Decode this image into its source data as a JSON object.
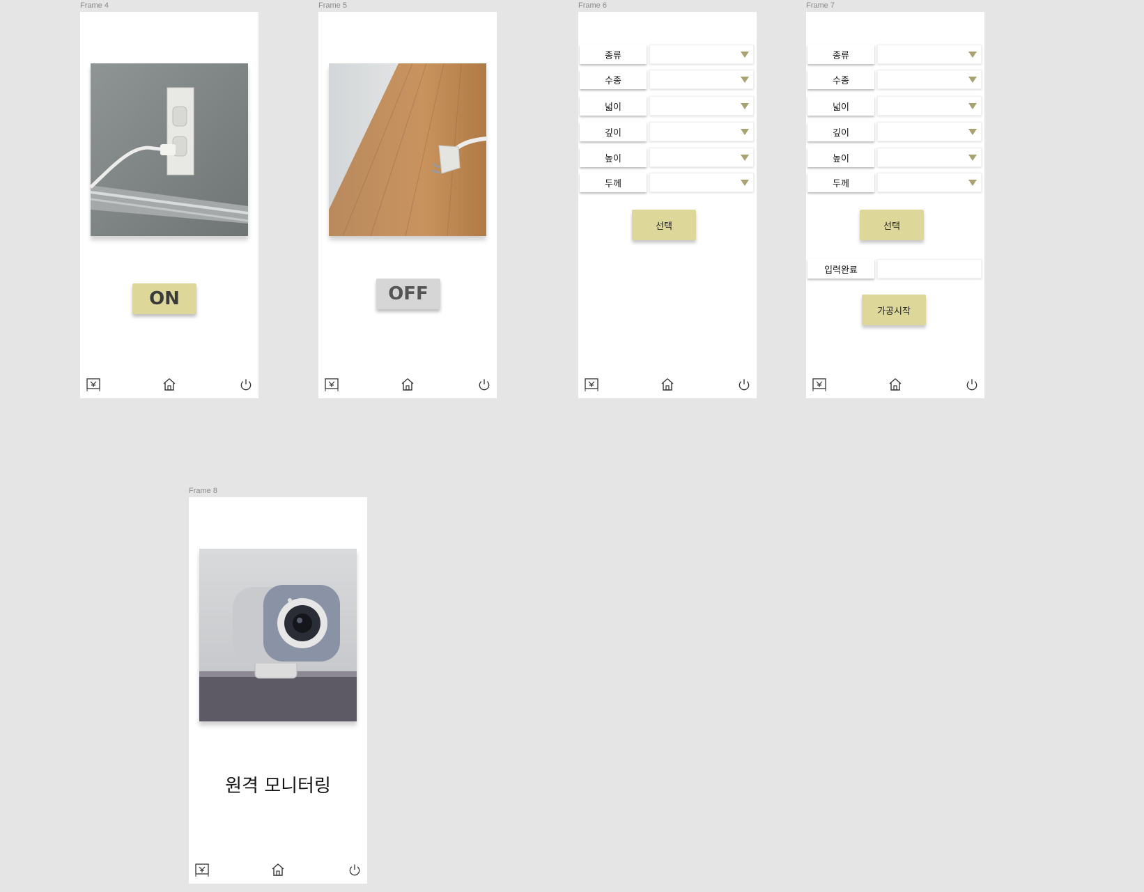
{
  "frames": {
    "f4": {
      "label": "Frame 4",
      "button": "ON"
    },
    "f5": {
      "label": "Frame 5",
      "button": "OFF"
    },
    "f6": {
      "label": "Frame 6",
      "fields": [
        "종류",
        "수종",
        "넓이",
        "깊이",
        "높이",
        "두께"
      ],
      "select_button": "선택"
    },
    "f7": {
      "label": "Frame 7",
      "fields": [
        "종류",
        "수종",
        "넓이",
        "깊이",
        "높이",
        "두께"
      ],
      "select_button": "선택",
      "input_label": "입력완료",
      "start_button": "가공시작"
    },
    "f8": {
      "label": "Frame 8",
      "title": "원격 모니터링"
    }
  },
  "nav": {
    "icons": [
      "tracker-icon",
      "home-icon",
      "power-icon"
    ]
  },
  "colors": {
    "accent": "#ddd79a",
    "caret": "#a7a270",
    "canvas": "#e5e5e5",
    "off_button": "#d6d6d6"
  }
}
